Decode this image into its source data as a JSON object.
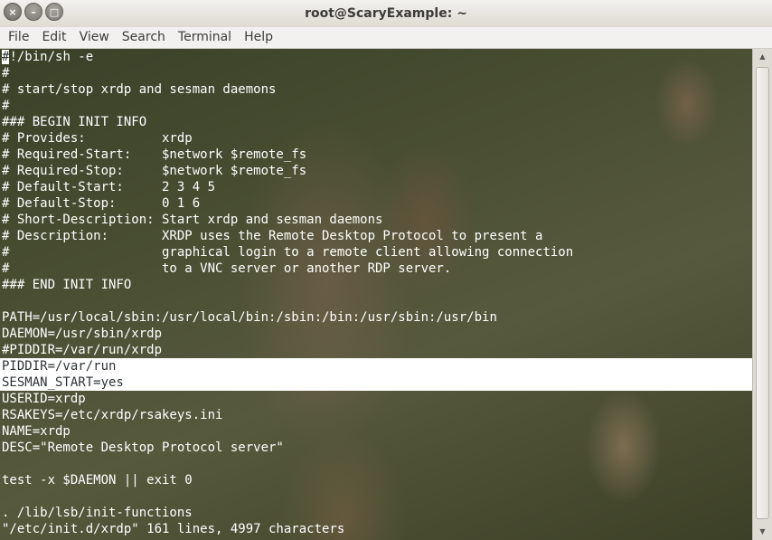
{
  "window": {
    "title": "root@ScaryExample: ~",
    "buttons": {
      "close": "×",
      "minimize": "–",
      "maximize": "□"
    }
  },
  "menubar": [
    "File",
    "Edit",
    "View",
    "Search",
    "Terminal",
    "Help"
  ],
  "terminal": {
    "cursor_char": "#",
    "first_line_rest": "!/bin/sh -e",
    "lines": [
      "#",
      "# start/stop xrdp and sesman daemons",
      "#",
      "### BEGIN INIT INFO",
      "# Provides:          xrdp",
      "# Required-Start:    $network $remote_fs",
      "# Required-Stop:     $network $remote_fs",
      "# Default-Start:     2 3 4 5",
      "# Default-Stop:      0 1 6",
      "# Short-Description: Start xrdp and sesman daemons",
      "# Description:       XRDP uses the Remote Desktop Protocol to present a",
      "#                    graphical login to a remote client allowing connection",
      "#                    to a VNC server or another RDP server.",
      "### END INIT INFO",
      "",
      "PATH=/usr/local/sbin:/usr/local/bin:/sbin:/bin:/usr/sbin:/usr/bin",
      "DAEMON=/usr/sbin/xrdp",
      "#PIDDIR=/var/run/xrdp",
      "PIDDIR=/var/run",
      "SESMAN_START=yes",
      "USERID=xrdp",
      "RSAKEYS=/etc/xrdp/rsakeys.ini",
      "NAME=xrdp",
      "DESC=\"Remote Desktop Protocol server\"",
      "",
      "test -x $DAEMON || exit 0",
      "",
      ". /lib/lsb/init-functions",
      "\"/etc/init.d/xrdp\" 161 lines, 4997 characters"
    ],
    "highlighted_line_indices": [
      18,
      19
    ]
  }
}
